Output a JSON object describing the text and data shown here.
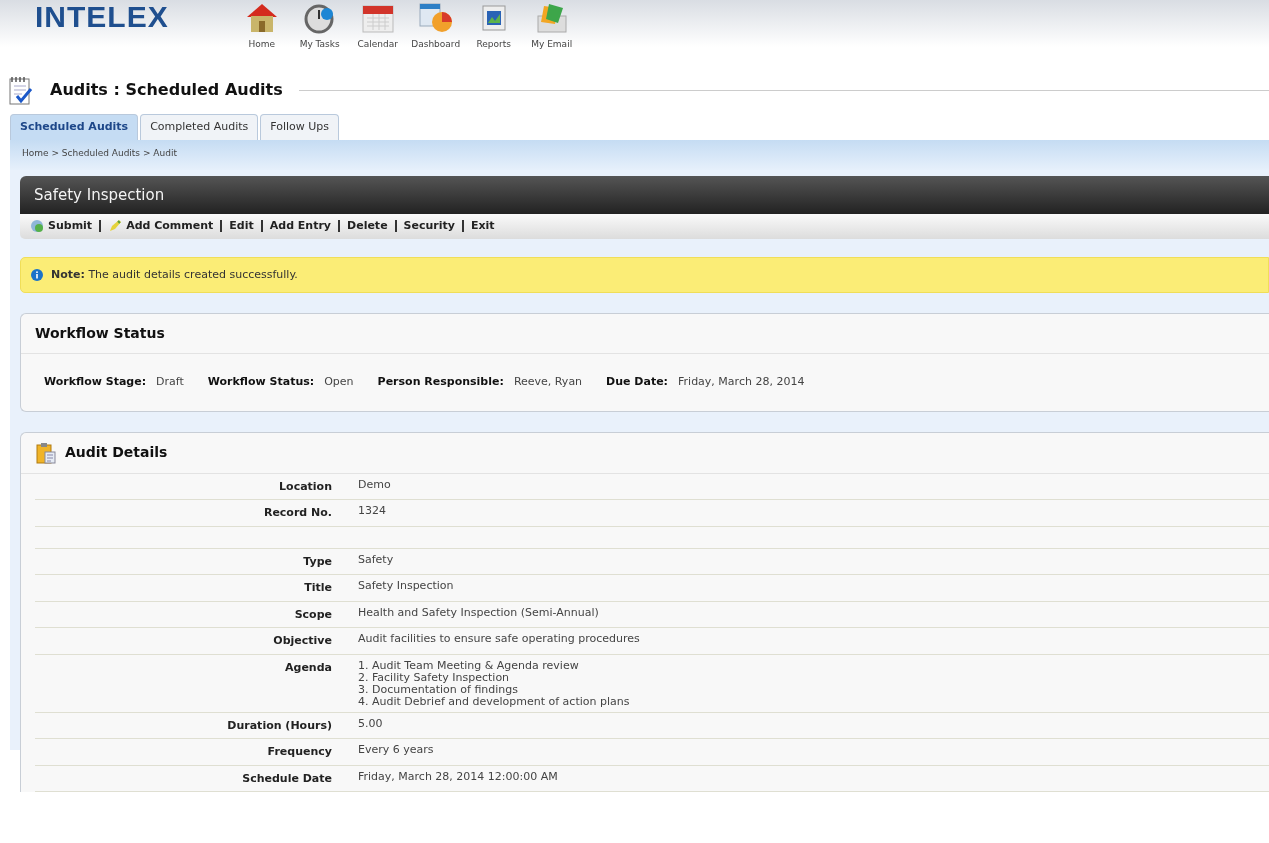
{
  "logo": "INTELEX",
  "nav": [
    {
      "label": "Home",
      "kind": "house"
    },
    {
      "label": "My Tasks",
      "kind": "stopwatch"
    },
    {
      "label": "Calendar",
      "kind": "calendar"
    },
    {
      "label": "Dashboard",
      "kind": "chart"
    },
    {
      "label": "Reports",
      "kind": "report"
    },
    {
      "label": "My Email",
      "kind": "email"
    }
  ],
  "page_title": "Audits : Scheduled Audits",
  "tabs": [
    {
      "label": "Scheduled Audits",
      "selected": true
    },
    {
      "label": "Completed Audits",
      "selected": false
    },
    {
      "label": "Follow Ups",
      "selected": false
    }
  ],
  "breadcrumb": "Home > Scheduled Audits > Audit",
  "record_title": "Safety Inspection",
  "toolbar": [
    {
      "label": "Submit",
      "kind": "submit"
    },
    {
      "label": "Add Comment",
      "kind": "comment"
    },
    {
      "label": "Edit",
      "kind": "plain"
    },
    {
      "label": "Add Entry",
      "kind": "plain"
    },
    {
      "label": "Delete",
      "kind": "plain"
    },
    {
      "label": "Security",
      "kind": "plain"
    },
    {
      "label": "Exit",
      "kind": "plain"
    }
  ],
  "note": "**Note:** The audit details created successfully.",
  "workflow": {
    "title": "Workflow Status",
    "fields": [
      {
        "label": "Workflow Stage:",
        "value": "Draft"
      },
      {
        "label": "Workflow Status:",
        "value": "Open"
      },
      {
        "label": "Person Responsible:",
        "value": "Reeve, Ryan"
      },
      {
        "label": "Due Date:",
        "value": "Friday, March 28, 2014"
      }
    ]
  },
  "details": {
    "title": "Audit Details",
    "rows": [
      {
        "label": "Location",
        "lines": [
          "Demo"
        ]
      },
      {
        "label": "Record No.",
        "lines": [
          "1324"
        ]
      },
      {
        "kind": "blank"
      },
      {
        "label": "Type",
        "lines": [
          "Safety"
        ]
      },
      {
        "label": "Title",
        "lines": [
          "Safety Inspection"
        ]
      },
      {
        "label": "Scope",
        "lines": [
          "Health and Safety Inspection (Semi-Annual)"
        ]
      },
      {
        "label": "Objective",
        "lines": [
          "Audit facilities to ensure safe operating procedures"
        ]
      },
      {
        "label": "Agenda",
        "lines": [
          "1. Audit Team Meeting & Agenda review",
          "2. Facility Safety Inspection",
          "3. Documentation of findings",
          "4. Audit Debrief and development of action plans"
        ]
      },
      {
        "label": "Duration (Hours)",
        "lines": [
          "5.00"
        ]
      },
      {
        "label": "Frequency",
        "lines": [
          "Every 6 years"
        ]
      },
      {
        "label": "Schedule Date",
        "lines": [
          "Friday, March 28, 2014 12:00:00 AM"
        ]
      }
    ]
  }
}
